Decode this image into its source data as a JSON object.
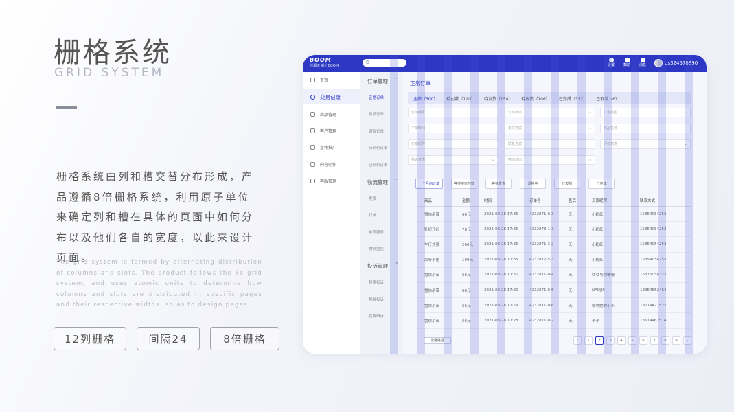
{
  "slide": {
    "title_cn": "栅格系统",
    "title_en": "GRID SYSTEM",
    "description_cn": "栅格系统由列和槽交替分布形成，产品遵循8倍栅格系统，利用原子单位来确定列和槽在具体的页面中如何分布以及他们各自的宽度，以此来设计页面。",
    "description_en": "The grid system is formed by alternating distribution of columns and slots. The product follows the 8x grid system, and uses atomic units to determine how columns and slots are distributed in specific pages and their respective widths, so as to design pages.",
    "pills": [
      "12列栅格",
      "间隔24",
      "8倍栅格"
    ]
  },
  "app": {
    "brand_name": "BOOM",
    "brand_sub": "线潮流 就上BOOM",
    "toolbar": [
      {
        "label": "设置",
        "icon": "gear-icon"
      },
      {
        "label": "帮助",
        "icon": "help-icon"
      },
      {
        "label": "消息",
        "icon": "message-icon"
      }
    ],
    "user": "ds324578890",
    "sidebar": [
      {
        "label": "首页",
        "icon": "home-icon"
      },
      {
        "label": "交易记录",
        "icon": "dollar-icon"
      },
      {
        "label": "商品管理",
        "icon": "goods-icon"
      },
      {
        "label": "客户管理",
        "icon": "customer-icon"
      },
      {
        "label": "宣传推广",
        "icon": "promotion-icon"
      },
      {
        "label": "内容创作",
        "icon": "content-icon"
      },
      {
        "label": "客服管理",
        "icon": "service-icon"
      }
    ],
    "submenu": {
      "orders": {
        "title": "订单管理",
        "items": [
          "正常订单",
          "换货订单",
          "退款订单",
          "待评价订单",
          "已评价订单"
        ]
      },
      "logistics": {
        "title": "物流管理",
        "items": [
          "发货",
          "打单",
          "物流服务",
          "物流监控"
        ]
      },
      "complaints": {
        "title": "投诉管理",
        "items": [
          "我要投诉",
          "我被投诉",
          "我要申诉"
        ]
      }
    },
    "page_title": "正常订单",
    "status_tabs": [
      "全部（500）",
      "待付款（120）",
      "待发货（150）",
      "待收货（106）",
      "已完成（312）",
      "已取消（6）"
    ],
    "filters": [
      "订单编号",
      "订单状态",
      "订单类型",
      "下单时间",
      "支付方式",
      "商品名称",
      "买家昵称",
      "联系方式",
      "评价状态",
      "投诉状态",
      "物流状态"
    ],
    "actions": [
      "一个月内订单",
      "等待买家付款",
      "等待发货",
      "退换中",
      "已发货",
      "已完成"
    ],
    "table": {
      "headers": [
        "商品",
        "金额",
        "时间",
        "订单号",
        "售后",
        "买家昵称",
        "联系方式"
      ],
      "rows": [
        [
          "雪纺吊带",
          "66元",
          "2021-08-28 17:35",
          "4232871-0-3",
          "无",
          "小粉红",
          "15354054253"
        ],
        [
          "针织开衫",
          "78元",
          "2021-08-28 17:35",
          "4232873-1-3",
          "无",
          "小粉红",
          "15354054253"
        ],
        [
          "牛仔外套",
          "266元",
          "2021-08-28 17:35",
          "4232871-3-2",
          "无",
          "小粉红",
          "15354054253"
        ],
        [
          "风琴半裙",
          "199元",
          "2021-08-28 17:35",
          "4232872-5-3",
          "无",
          "小粉红",
          "15354054253"
        ],
        [
          "雪纺吊带",
          "66元",
          "2021-08-28 17:30",
          "4232871-0-4",
          "无",
          "咕咕与你嗯嗯",
          "16376054323"
        ],
        [
          "雪纺吊带",
          "66元",
          "2021-08-28 17:30",
          "4232871-0-5",
          "无",
          "NADJIS",
          "13354652464"
        ],
        [
          "雪纺吊带",
          "66元",
          "2021-08-28 17:29",
          "4232871-0-6",
          "无",
          "嘀嘀她的小小",
          "18714477522"
        ],
        [
          "雪纺吊带",
          "66元",
          "2021-08-28 17:28",
          "4232871-0-7",
          "无",
          "卡卡",
          "13614462514"
        ]
      ]
    },
    "bulk_label": "批量处理",
    "pager": [
      "‹",
      "1",
      "2",
      "3",
      "4",
      "5",
      "6",
      "7",
      "8",
      "9",
      "›"
    ],
    "pager_active": "2",
    "colors": {
      "accent": "#2c37c4",
      "grid_overlay": "#4655d7"
    }
  }
}
